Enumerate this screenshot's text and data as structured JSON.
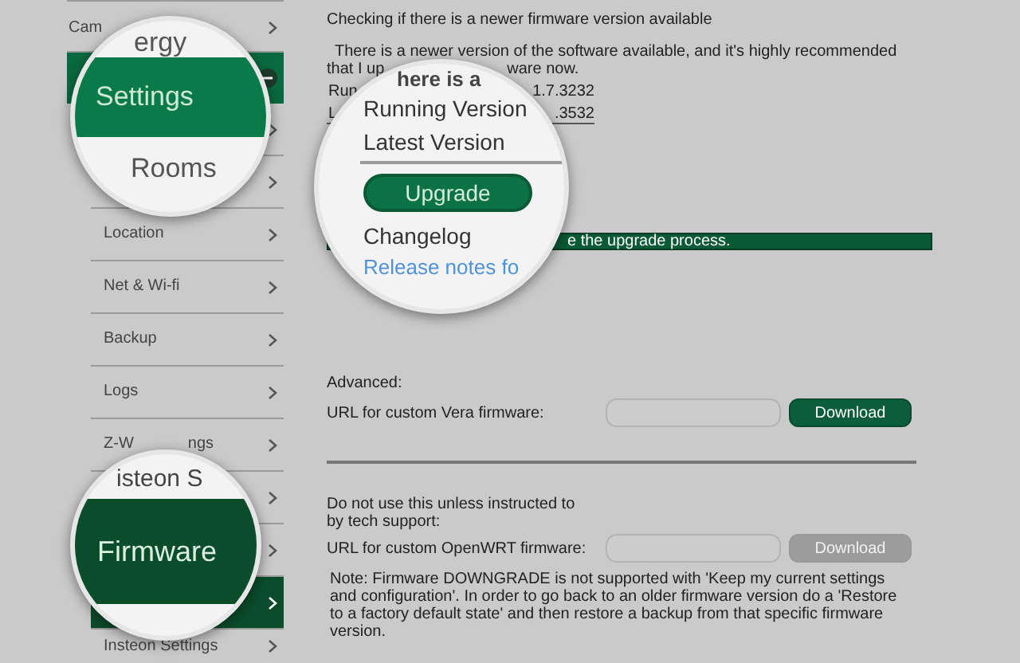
{
  "sidebar": {
    "items": [
      {
        "kind": "item",
        "label": "Cam",
        "selected": false
      },
      {
        "kind": "section",
        "expanded": true
      },
      {
        "kind": "sub",
        "selected": false
      },
      {
        "kind": "sub",
        "selected": false
      },
      {
        "kind": "sub",
        "label": "Location",
        "selected": false
      },
      {
        "kind": "sub",
        "label": "Net & Wi-fi",
        "selected": false
      },
      {
        "kind": "sub",
        "label": "Backup",
        "selected": false
      },
      {
        "kind": "sub",
        "label": "Logs",
        "selected": false
      },
      {
        "kind": "sub",
        "label": "Z-W",
        "label_end": "ngs",
        "selected": false
      },
      {
        "kind": "sub",
        "selected": false
      },
      {
        "kind": "sub",
        "selected": false
      },
      {
        "kind": "sub",
        "selected": true
      },
      {
        "kind": "sub",
        "label": "Insteon Settings",
        "selected": false
      }
    ]
  },
  "main": {
    "heading": "Checking if there is a newer firmware version available",
    "notice": [
      "There is a newer version of the software available, and it's highly recommended",
      "that I up",
      "ware now."
    ],
    "running": [
      "Run",
      "1.7.3232"
    ],
    "latest": [
      "L",
      ".3532"
    ],
    "progress_text": "e the upgrade process.",
    "advanced": {
      "title": "Advanced:",
      "label": "URL for custom Vera firmware:",
      "button": {
        "label": "Download",
        "disabled": false
      }
    },
    "custom": {
      "warning": "Do not use this unless instructed to by tech support:",
      "label": "URL for custom OpenWRT firmware:",
      "button": {
        "label": "Download",
        "disabled": true
      }
    },
    "note": "Note: Firmware DOWNGRADE is not supported with 'Keep my current settings and configuration'. In order to go back to an older firmware version do a 'Restore to a factory default state' and then restore a backup from that specific firmware version."
  },
  "magnifiers": [
    {
      "lines": [
        {
          "kind": "text",
          "text": "ergy"
        },
        {
          "kind": "band",
          "text": "Settings"
        },
        {
          "kind": "text",
          "text": "Rooms"
        }
      ]
    },
    {
      "lines": [
        {
          "kind": "text",
          "text": "here is a"
        },
        {
          "kind": "text",
          "text": "Running Version"
        },
        {
          "kind": "text",
          "text": "Latest Version"
        },
        {
          "kind": "rule"
        },
        {
          "kind": "button",
          "text": "Upgrade"
        },
        {
          "kind": "text",
          "text": "Changelog"
        },
        {
          "kind": "link",
          "text": "Release notes fo"
        }
      ]
    },
    {
      "lines": [
        {
          "kind": "text",
          "text": "isteon S"
        },
        {
          "kind": "band",
          "text": "Firmware"
        }
      ]
    }
  ]
}
